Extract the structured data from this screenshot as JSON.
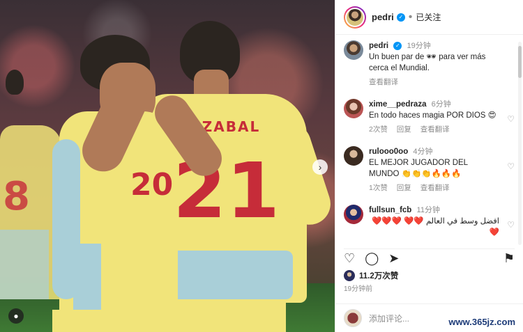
{
  "post_author": {
    "username": "pedri",
    "follow_state": "已关注"
  },
  "caption": {
    "username": "pedri",
    "time": "19分钟",
    "text": "Un buen par de 🕶 para ver más cerca el Mundial.",
    "translate": "查看翻译"
  },
  "comments": [
    {
      "username": "xime__pedraza",
      "time": "6分钟",
      "text": "En todo haces magia POR DIOS 😍",
      "likes": "2次赞",
      "reply": "回复",
      "translate": "查看翻译"
    },
    {
      "username": "rulooo0oo",
      "time": "4分钟",
      "text": "EL MEJOR JUGADOR DEL MUNDO 👏👏👏🔥🔥🔥",
      "likes": "1次赞",
      "reply": "回复",
      "translate": "查看翻译"
    },
    {
      "username": "fullsun_fcb",
      "time": "11分钟",
      "text": "افضل وسط في العالم ❤️❤️ ❤️❤️❤️❤️"
    }
  ],
  "engagement": {
    "likes": "11.2万次赞",
    "posted": "19分钟前"
  },
  "add_comment": {
    "placeholder": "添加评论..."
  },
  "photo": {
    "numbers": [
      "20",
      "21"
    ],
    "name_on_shirt": "OYARZABAL"
  },
  "watermark": "www.365jz.com",
  "icons": {
    "like": "heart-icon",
    "comment": "comment-icon",
    "share": "send-icon",
    "save": "bookmark-icon"
  }
}
